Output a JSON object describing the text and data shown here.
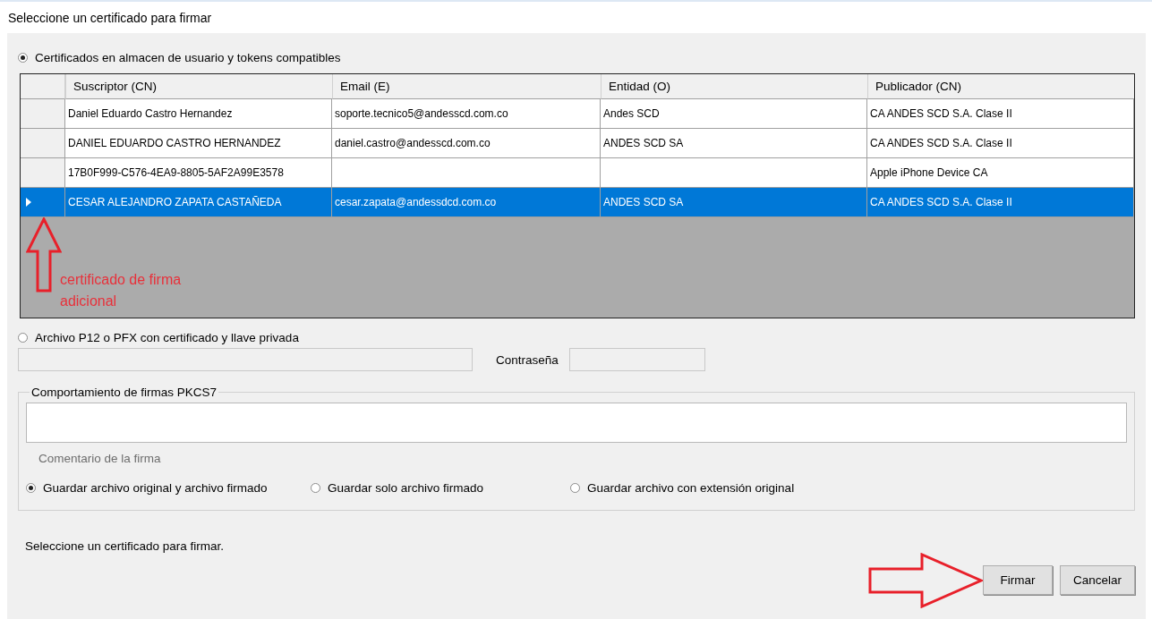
{
  "window": {
    "title": "Seleccione un certificado para firmar"
  },
  "store_option": {
    "label": "Certificados en almacen de usuario y tokens compatibles",
    "selected": true
  },
  "table": {
    "columns": [
      "Suscriptor (CN)",
      "Email (E)",
      "Entidad (O)",
      "Publicador (CN)"
    ],
    "rows": [
      {
        "cells": [
          "Daniel Eduardo Castro Hernandez",
          "soporte.tecnico5@andesscd.com.co",
          "Andes SCD",
          "CA ANDES SCD S.A. Clase II"
        ],
        "selected": false
      },
      {
        "cells": [
          "DANIEL EDUARDO CASTRO HERNANDEZ",
          "daniel.castro@andesscd.com.co",
          "ANDES SCD SA",
          "CA ANDES SCD S.A. Clase II"
        ],
        "selected": false
      },
      {
        "cells": [
          "17B0F999-C576-4EA9-8805-5AF2A99E3578",
          null,
          null,
          "Apple iPhone Device CA"
        ],
        "selected": false
      },
      {
        "cells": [
          "CESAR ALEJANDRO ZAPATA CASTAÑEDA",
          "cesar.zapata@andessdcd.com.co",
          "ANDES SCD SA",
          "CA ANDES SCD S.A. Clase II"
        ],
        "selected": true
      }
    ],
    "annotation": "certificado de firma adicional"
  },
  "file_option": {
    "label": "Archivo P12 o PFX con certificado y llave privada",
    "selected": false
  },
  "password_label": "Contraseña",
  "pkcs7": {
    "title": "Comportamiento de firmas PKCS7",
    "comment_label": "Comentario de la firma",
    "options": [
      {
        "label": "Guardar archivo original y archivo firmado",
        "selected": true
      },
      {
        "label": "Guardar solo archivo firmado",
        "selected": false
      },
      {
        "label": "Guardar archivo con extensión original",
        "selected": false
      }
    ]
  },
  "status": "Seleccione un certificado para firmar.",
  "buttons": [
    {
      "label": "Firmar",
      "annotated": true
    },
    {
      "label": "Cancelar",
      "annotated": false
    }
  ]
}
